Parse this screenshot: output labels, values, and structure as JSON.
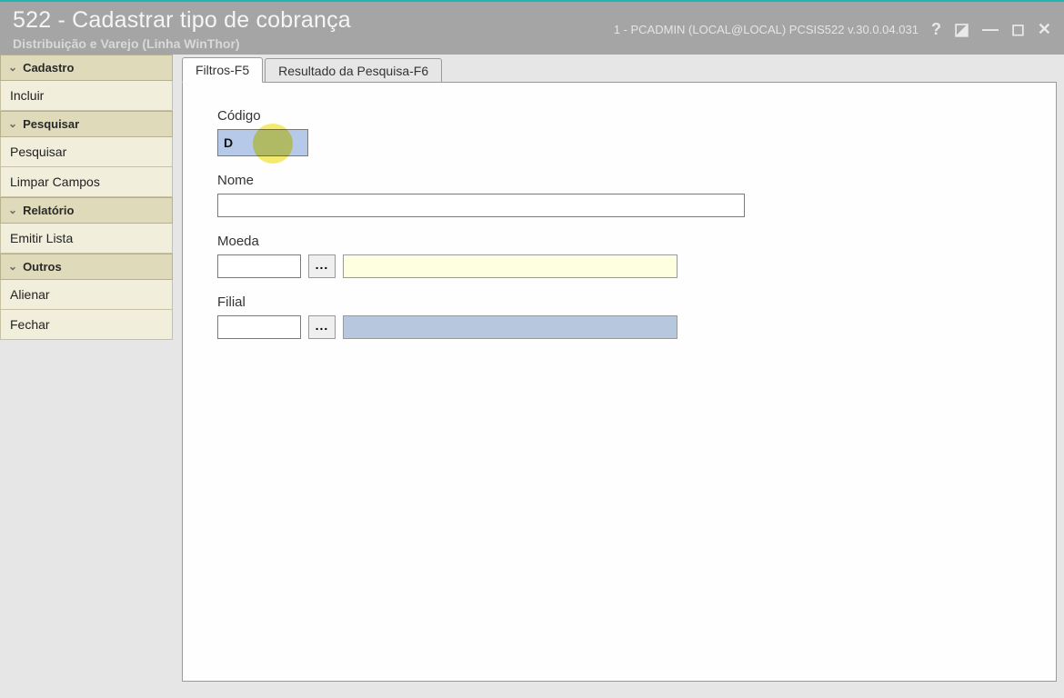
{
  "header": {
    "title": "522 - Cadastrar tipo de cobrança",
    "subtitle": "Distribuição e Varejo (Linha WinThor)",
    "status": "1 - PCADMIN (LOCAL@LOCAL)   PCSIS522   v.30.0.04.031"
  },
  "controls": {
    "help": "?",
    "edit": "◪",
    "min": "—",
    "max": "◻",
    "close": "✕"
  },
  "sidebar": {
    "groups": [
      {
        "header": "Cadastro",
        "items": [
          "Incluir"
        ]
      },
      {
        "header": "Pesquisar",
        "items": [
          "Pesquisar",
          "Limpar Campos"
        ]
      },
      {
        "header": "Relatório",
        "items": [
          "Emitir Lista"
        ]
      },
      {
        "header": "Outros",
        "items": [
          "Alienar",
          "Fechar"
        ]
      }
    ]
  },
  "tabs": {
    "filtros": "Filtros-F5",
    "resultado": "Resultado da Pesquisa-F6"
  },
  "form": {
    "codigo_label": "Código",
    "codigo_value": "D",
    "nome_label": "Nome",
    "nome_value": "",
    "moeda_label": "Moeda",
    "moeda_code": "",
    "moeda_desc": "",
    "filial_label": "Filial",
    "filial_code": "",
    "filial_desc": "",
    "lookup_text": "..."
  }
}
